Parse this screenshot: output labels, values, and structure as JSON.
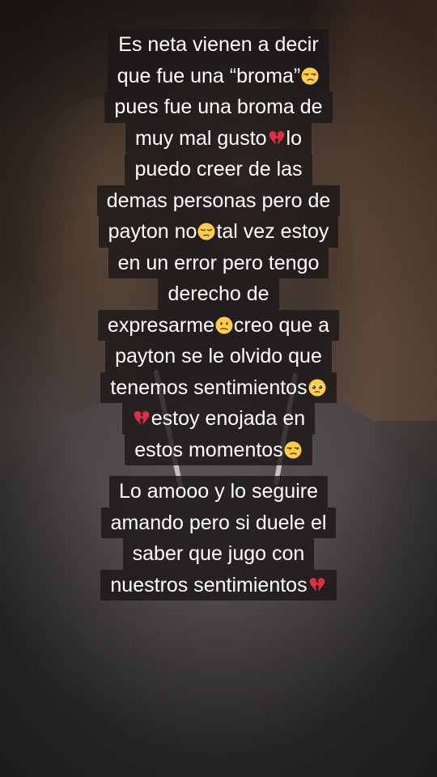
{
  "captions": [
    {
      "lines": [
        [
          "Es neta vienen a decir"
        ],
        [
          "que fue una “broma”",
          {
            "icon": "unamused-face-emoji"
          }
        ],
        [
          "pues fue una broma de"
        ],
        [
          "muy mal gusto",
          {
            "icon": "broken-heart-emoji"
          },
          "lo"
        ],
        [
          "puedo creer de las"
        ],
        [
          "demas personas pero de"
        ],
        [
          "payton no",
          {
            "icon": "pensive-face-emoji"
          },
          "tal vez estoy"
        ],
        [
          "en un error pero tengo"
        ],
        [
          "derecho de"
        ],
        [
          "expresarme",
          {
            "icon": "confused-face-emoji"
          },
          "creo que a"
        ],
        [
          "payton se le olvido que"
        ],
        [
          "tenemos sentimientos",
          {
            "icon": "pleading-face-emoji"
          }
        ],
        [
          {
            "icon": "broken-heart-emoji"
          },
          "estoy enojada en"
        ],
        [
          "estos momentos",
          {
            "icon": "unamused-face-emoji"
          }
        ]
      ]
    },
    {
      "lines": [
        [
          "Lo amooo y lo seguire"
        ],
        [
          "amando pero si duele el"
        ],
        [
          "saber que jugo con"
        ],
        [
          "nuestros sentimientos",
          {
            "icon": "broken-heart-emoji"
          }
        ]
      ]
    }
  ],
  "colors": {
    "caption_text": "#ffffff",
    "caption_background": "#1c1818",
    "emoji_face": "#ffcc4d",
    "emoji_heart": "#dd2e44"
  }
}
